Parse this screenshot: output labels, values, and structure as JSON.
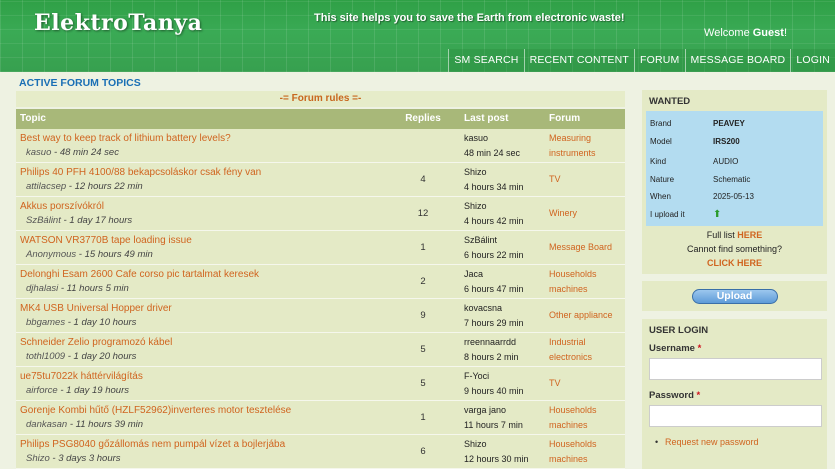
{
  "header": {
    "logo": "ElektroTanya",
    "tagline": "This site helps you to save the Earth from electronic waste!",
    "welcome_prefix": "Welcome ",
    "welcome_user": "Guest",
    "welcome_suffix": "!"
  },
  "nav": [
    "SM SEARCH",
    "RECENT CONTENT",
    "FORUM",
    "MESSAGE BOARD",
    "LOGIN"
  ],
  "main": {
    "title": "ACTIVE FORUM TOPICS",
    "rules": "-= Forum rules =-",
    "columns": {
      "topic": "Topic",
      "replies": "Replies",
      "last": "Last post",
      "forum": "Forum"
    },
    "topics": [
      {
        "title": "Best way to keep track of lithium battery levels?",
        "author": "kasuo",
        "age": "48 min 24 sec",
        "replies": "",
        "last_user": "kasuo",
        "last_time": "48 min 24 sec",
        "forum_1": "Measuring",
        "forum_2": "instruments"
      },
      {
        "title": "Philips 40 PFH 4100/88 bekapcsoláskor csak fény van",
        "author": "attilacsep",
        "age": "12 hours 22 min",
        "replies": "4",
        "last_user": "Shizo",
        "last_time": "4 hours 34 min",
        "forum_1": "TV",
        "forum_2": ""
      },
      {
        "title": "Akkus porszívókról",
        "author": "SzBálint",
        "age": "1 day 17 hours",
        "replies": "12",
        "last_user": "Shizo",
        "last_time": "4 hours 42 min",
        "forum_1": "Winery",
        "forum_2": ""
      },
      {
        "title": "WATSON VR3770B tape loading issue",
        "author": "Anonymous",
        "age": "15 hours 49 min",
        "replies": "1",
        "last_user": "SzBálint",
        "last_time": "6 hours 22 min",
        "forum_1": "Message Board",
        "forum_2": ""
      },
      {
        "title": "Delonghi Esam 2600 Cafe corso pic tartalmat keresek",
        "author": "djhalasi",
        "age": "11 hours 5 min",
        "replies": "2",
        "last_user": "Jaca",
        "last_time": "6 hours 47 min",
        "forum_1": "Households",
        "forum_2": "machines"
      },
      {
        "title": "MK4 USB Universal Hopper driver",
        "author": "bbgames",
        "age": "1 day 10 hours",
        "replies": "9",
        "last_user": "kovacsna",
        "last_time": "7 hours 29 min",
        "forum_1": "Other appliance",
        "forum_2": ""
      },
      {
        "title": "Schneider Zelio programozó kábel",
        "author": "tothl1009",
        "age": "1 day 20 hours",
        "replies": "5",
        "last_user": "rreennaarrdd",
        "last_time": "8 hours 2 min",
        "forum_1": "Industrial",
        "forum_2": "electronics"
      },
      {
        "title": "ue75tu7022k háttérvilágítás",
        "author": "airforce",
        "age": "1 day 19 hours",
        "replies": "5",
        "last_user": "F-Yoci",
        "last_time": "9 hours 40 min",
        "forum_1": "TV",
        "forum_2": ""
      },
      {
        "title": "Gorenje Kombi hűtő (HZLF52962)inverteres motor tesztelése",
        "author": "dankasan",
        "age": "11 hours 39 min",
        "replies": "1",
        "last_user": "varga jano",
        "last_time": "11 hours 7 min",
        "forum_1": "Households",
        "forum_2": "machines"
      },
      {
        "title": "Philips PSG8040 gőzállomás nem pumpál vízet a bojlerjába",
        "author": "Shizo",
        "age": "3 days 3 hours",
        "replies": "6",
        "last_user": "Shizo",
        "last_time": "12 hours 30 min",
        "forum_1": "Households",
        "forum_2": "machines"
      }
    ]
  },
  "wanted": {
    "title": "WANTED",
    "rows": [
      {
        "k": "Brand",
        "v": "PEAVEY"
      },
      {
        "k": "Model",
        "v": "IRS200"
      },
      {
        "k": "Kind",
        "v": "AUDIO"
      },
      {
        "k": "Nature",
        "v": "Schematic"
      },
      {
        "k": "When",
        "v": "2025-05-13"
      },
      {
        "k": "I upload it",
        "v": "⬆"
      }
    ],
    "full_list": "Full list ",
    "here": "HERE",
    "cannot_find": "Cannot find something?",
    "click_here": "CLICK HERE"
  },
  "upload": {
    "label": "Upload"
  },
  "login": {
    "title": "USER LOGIN",
    "username_label": "Username",
    "password_label": "Password",
    "required_mark": "*",
    "request_password": "Request new password"
  }
}
